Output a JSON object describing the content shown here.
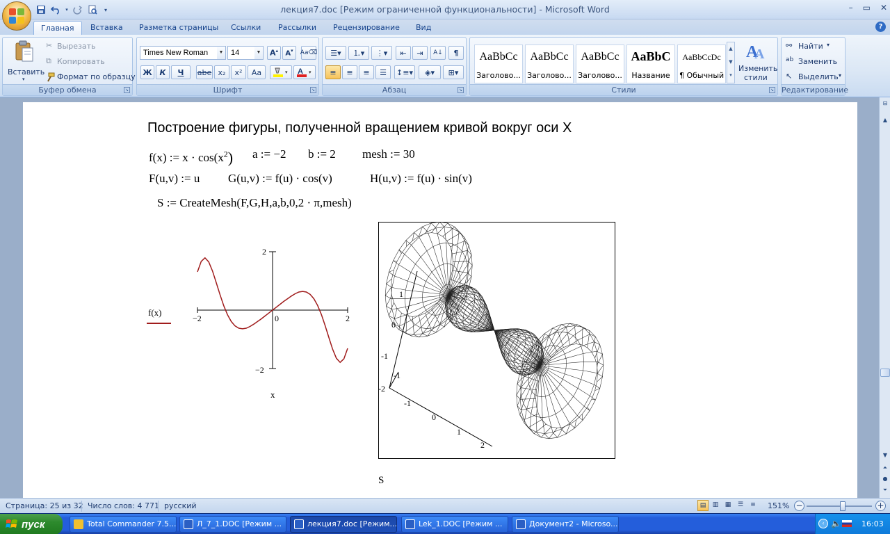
{
  "window": {
    "title": "лекция7.doc [Режим ограниченной функциональности] - Microsoft Word"
  },
  "tabs": [
    "Главная",
    "Вставка",
    "Разметка страницы",
    "Ссылки",
    "Рассылки",
    "Рецензирование",
    "Вид"
  ],
  "ribbon": {
    "clipboard": {
      "label": "Буфер обмена",
      "paste": "Вставить",
      "cut": "Вырезать",
      "copy": "Копировать",
      "format_painter": "Формат по образцу"
    },
    "font": {
      "label": "Шрифт",
      "font_name": "Times New Roman",
      "font_size": "14",
      "bold": "Ж",
      "italic": "К",
      "underline": "Ч",
      "strike": "abe",
      "subscript": "x₂",
      "superscript": "x²",
      "change_case": "Aa"
    },
    "paragraph": {
      "label": "Абзац"
    },
    "styles": {
      "label": "Стили",
      "items": [
        {
          "sample": "AaBbCc",
          "name": "Заголово..."
        },
        {
          "sample": "AaBbCc",
          "name": "Заголово..."
        },
        {
          "sample": "AaBbCc",
          "name": "Заголово..."
        },
        {
          "sample": "AaBbC",
          "name": "Название"
        },
        {
          "sample": "AaBbCcDc",
          "name": "¶ Обычный"
        }
      ],
      "change_styles": [
        "Изменить",
        "стили"
      ]
    },
    "editing": {
      "label": "Редактирование",
      "find": "Найти",
      "replace": "Заменить",
      "select": "Выделить"
    }
  },
  "document": {
    "heading": "Построение фигуры, полученной вращением кривой вокруг оси X",
    "line1": {
      "fx": "f(x) := x · cos(x",
      "exp": "2",
      "close": ")",
      "a": "a := −2",
      "b": "b := 2",
      "mesh": "mesh := 30"
    },
    "line2": {
      "F": "F(u,v) := u",
      "G": "G(u,v) := f(u) · cos(v)",
      "H": "H(u,v) := f(u) · sin(v)"
    },
    "line3": "S := CreateMesh(F,G,H,a,b,0,2 · π,mesh)",
    "plot2d": {
      "legend": "f(x)",
      "xlabel": "x",
      "ticks": {
        "ytop": "2",
        "ybottom": "−2",
        "xleft": "−2",
        "xright": "2",
        "origin": "0"
      }
    },
    "plot3d": {
      "label": "S",
      "zticks": [
        "1",
        "0",
        "-1",
        "-2"
      ],
      "yticks": [
        "-1"
      ],
      "xticks": [
        "-1",
        "0",
        "1",
        "2"
      ]
    }
  },
  "chart_data": {
    "type": "line",
    "x": [
      -2.0,
      -1.9,
      -1.8,
      -1.7,
      -1.6,
      -1.5,
      -1.4,
      -1.3,
      -1.2,
      -1.1,
      -1.0,
      -0.9,
      -0.8,
      -0.7,
      -0.6,
      -0.5,
      -0.4,
      -0.3,
      -0.2,
      -0.1,
      0.0,
      0.1,
      0.2,
      0.3,
      0.4,
      0.5,
      0.6,
      0.7,
      0.8,
      0.9,
      1.0,
      1.1,
      1.2,
      1.3,
      1.4,
      1.5,
      1.6,
      1.7,
      1.8,
      1.9,
      2.0
    ],
    "series": [
      {
        "name": "f(x)",
        "values": [
          1.31,
          1.67,
          1.79,
          1.65,
          1.34,
          0.94,
          0.53,
          0.15,
          -0.16,
          -0.39,
          -0.54,
          -0.62,
          -0.64,
          -0.62,
          -0.56,
          -0.48,
          -0.39,
          -0.3,
          -0.2,
          -0.1,
          0.0,
          0.1,
          0.2,
          0.3,
          0.39,
          0.48,
          0.56,
          0.62,
          0.64,
          0.62,
          0.54,
          0.39,
          0.16,
          -0.15,
          -0.53,
          -0.94,
          -1.34,
          -1.65,
          -1.79,
          -1.67,
          -1.31
        ]
      }
    ],
    "xlim": [
      -2,
      2
    ],
    "ylim": [
      -2,
      2
    ],
    "xlabel": "x",
    "color": "#a01c1c"
  },
  "status": {
    "page": "Страница: 25 из 32",
    "words": "Число слов: 4 771",
    "lang": "русский",
    "zoom": "151%"
  },
  "taskbar": {
    "start": "пуск",
    "tasks": [
      "Total Commander 7.5...",
      "Л_7_1.DOC [Режим ...",
      "лекция7.doc [Режим...",
      "Lek_1.DOC [Режим ...",
      "Документ2 - Microso..."
    ],
    "clock": "16:03"
  }
}
